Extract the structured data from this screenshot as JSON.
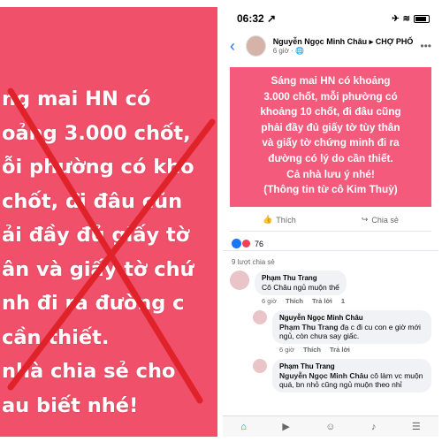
{
  "left_crop": {
    "lines": [
      "ng mai HN có",
      "oảng 3.000 chốt,",
      "ỗi phường có kho",
      "chốt, đi đâu cũn",
      "ải đầy đủ giấy tờ",
      "ân và giấy tờ chứ",
      "nh đi ra đường c",
      "cần thiết.",
      "nhà chia sẻ cho",
      "au biết nhé!"
    ],
    "mark_color": "#e0232b"
  },
  "status_bar": {
    "time": "06:32",
    "arrow": "↗",
    "airplane": "✈",
    "wifi": "≋"
  },
  "post": {
    "author": "Nguyễn Ngọc Minh Châu ▸ CHỢ PHỐ",
    "time": "6 giờ · ",
    "card_lines": [
      "Sáng mai HN có khoảng",
      "3.000 chốt, mỗi phường có",
      "khoảng 10 chốt, đi đâu cũng",
      "phải đầy đủ giấy tờ tùy thân",
      "và giấy tờ chứng minh đi ra",
      "đường có lý do cần thiết.",
      "Cả nhà lưu ý nhé!",
      "(Thông tin từ cô Kim Thuỳ)"
    ],
    "card_color": "#f45a7b",
    "like_label": "Thích",
    "share_label": "Chia sẻ",
    "reaction_count": "76",
    "shares_text": "9 lượt chia sẻ"
  },
  "comments": [
    {
      "name": "Phạm Thu Trang",
      "text": "Cô Châu ngủ muộn thế",
      "time": "6 giờ",
      "like": "Thích",
      "reply": "Trả lời",
      "reactions": "1"
    },
    {
      "name": "Nguyễn Ngọc Minh Châu",
      "mention": "Phạm Thu Trang",
      "text": " đạ c đi cu con e giờ mới ngủ, còn chưa say giấc.",
      "time": "6 giờ",
      "like": "Thích",
      "reply": "Trả lời"
    },
    {
      "name": "Phạm Thu Trang",
      "mention": "Nguyễn Ngọc Minh Châu",
      "text": " cô làm vc muộn quá, bn nhỏ cũng ngủ muộn theo nhỉ"
    }
  ],
  "tabs": [
    "home-icon",
    "video-icon",
    "groups-icon",
    "notifications-icon",
    "menu-icon"
  ],
  "colors": {
    "facebook_blue": "#1877f2",
    "pink_bg": "#f0506a"
  }
}
